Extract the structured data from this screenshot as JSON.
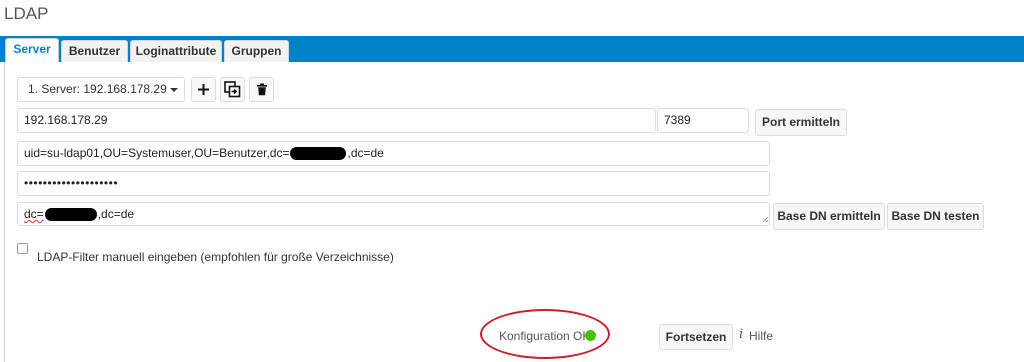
{
  "page": {
    "title": "LDAP"
  },
  "tabs": [
    {
      "label": "Server",
      "active": true
    },
    {
      "label": "Benutzer",
      "active": false
    },
    {
      "label": "Loginattribute",
      "active": false
    },
    {
      "label": "Gruppen",
      "active": false
    }
  ],
  "server": {
    "selected": "1. Server: 192.168.178.29",
    "add_icon": "plus-icon",
    "copy_icon": "copy-config-icon",
    "delete_icon": "trash-icon"
  },
  "host": {
    "value": "192.168.178.29"
  },
  "port": {
    "value": "7389",
    "detect_label": "Port ermitteln"
  },
  "user_dn": {
    "value_prefix": "uid=su-ldap01,OU=Systemuser,OU=Benutzer,dc=",
    "value_suffix": ",dc=de"
  },
  "password": {
    "masked": "••••••••••••••••••••"
  },
  "base_dn": {
    "value_prefix": "dc=",
    "value_suffix": ",dc=de",
    "detect_label": "Base DN ermitteln",
    "test_label": "Base DN testen"
  },
  "manual_filter": {
    "label": "LDAP-Filter manuell eingeben (empfohlen für große Verzeichnisse)",
    "checked": false
  },
  "footer": {
    "status_text": "Konfiguration OK",
    "status_color": "#43c000",
    "continue_label": "Fortsetzen",
    "info_icon": "info-icon",
    "help_label": "Hilfe"
  },
  "colors": {
    "accent": "#0082c9",
    "highlight": "#c8202a"
  }
}
